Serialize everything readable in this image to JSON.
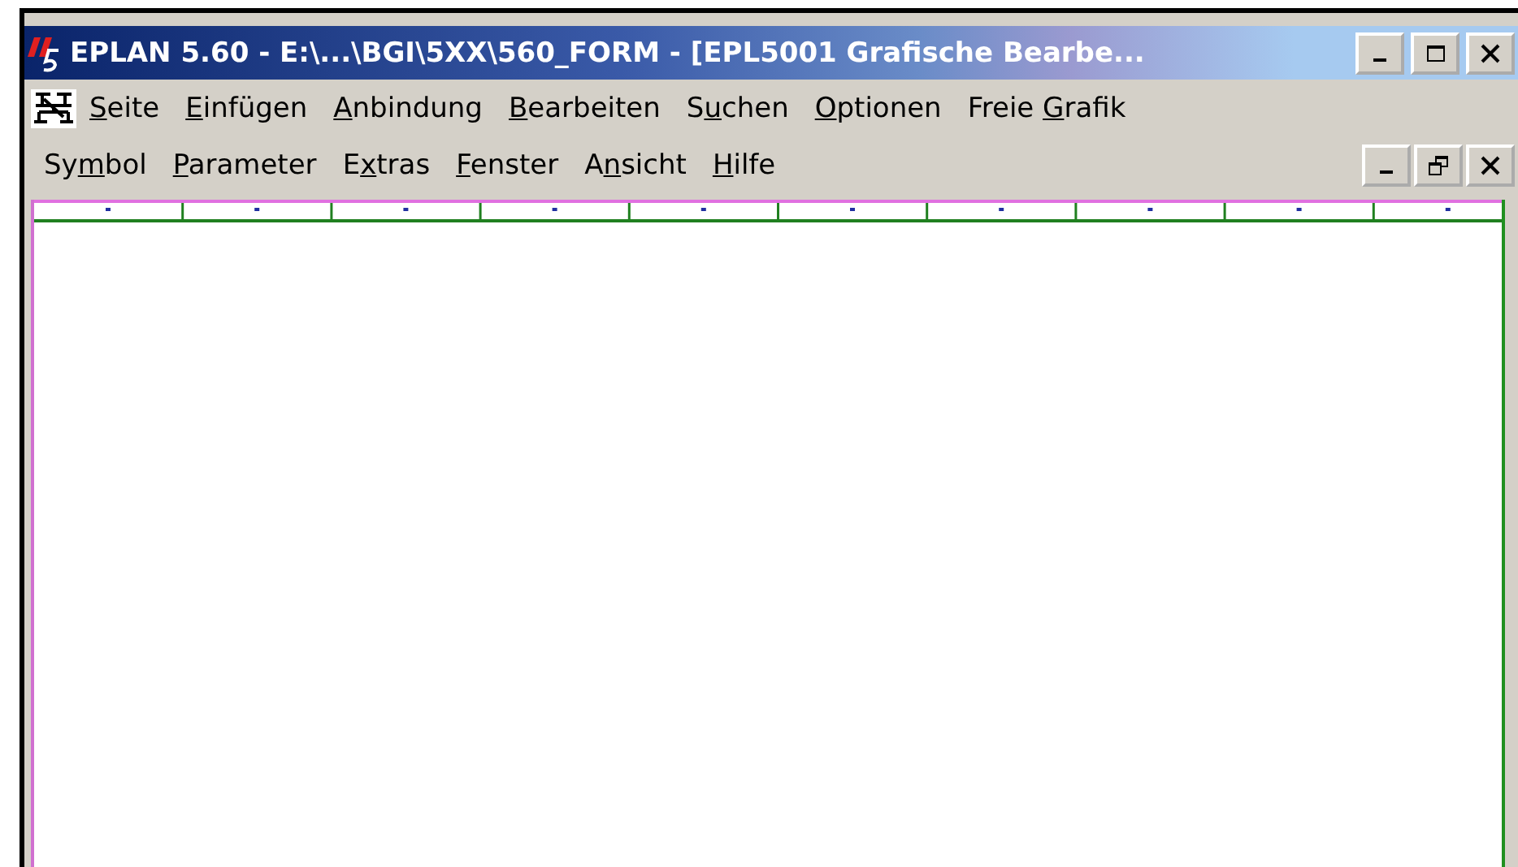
{
  "window": {
    "title": "EPLAN 5.60 - E:\\...\\BGI\\5XX\\560_FORM - [EPL5001 Grafische Bearbe..."
  },
  "menu_row_1": [
    {
      "key": "S",
      "post": "eite"
    },
    {
      "key": "E",
      "post": "infügen"
    },
    {
      "key": "A",
      "post": "nbindung"
    },
    {
      "key": "B",
      "post": "earbeiten"
    },
    {
      "pre": "S",
      "key": "u",
      "post": "chen"
    },
    {
      "key": "O",
      "post": "ptionen"
    },
    {
      "pre": "Freie ",
      "key": "G",
      "post": "rafik"
    }
  ],
  "menu_row_2": [
    {
      "pre": "Sy",
      "key": "m",
      "post": "bol"
    },
    {
      "key": "P",
      "post": "arameter"
    },
    {
      "pre": "E",
      "key": "x",
      "post": "tras"
    },
    {
      "key": "F",
      "post": "enster"
    },
    {
      "pre": "A",
      "key": "n",
      "post": "sicht"
    },
    {
      "key": "H",
      "post": "ilfe"
    }
  ]
}
